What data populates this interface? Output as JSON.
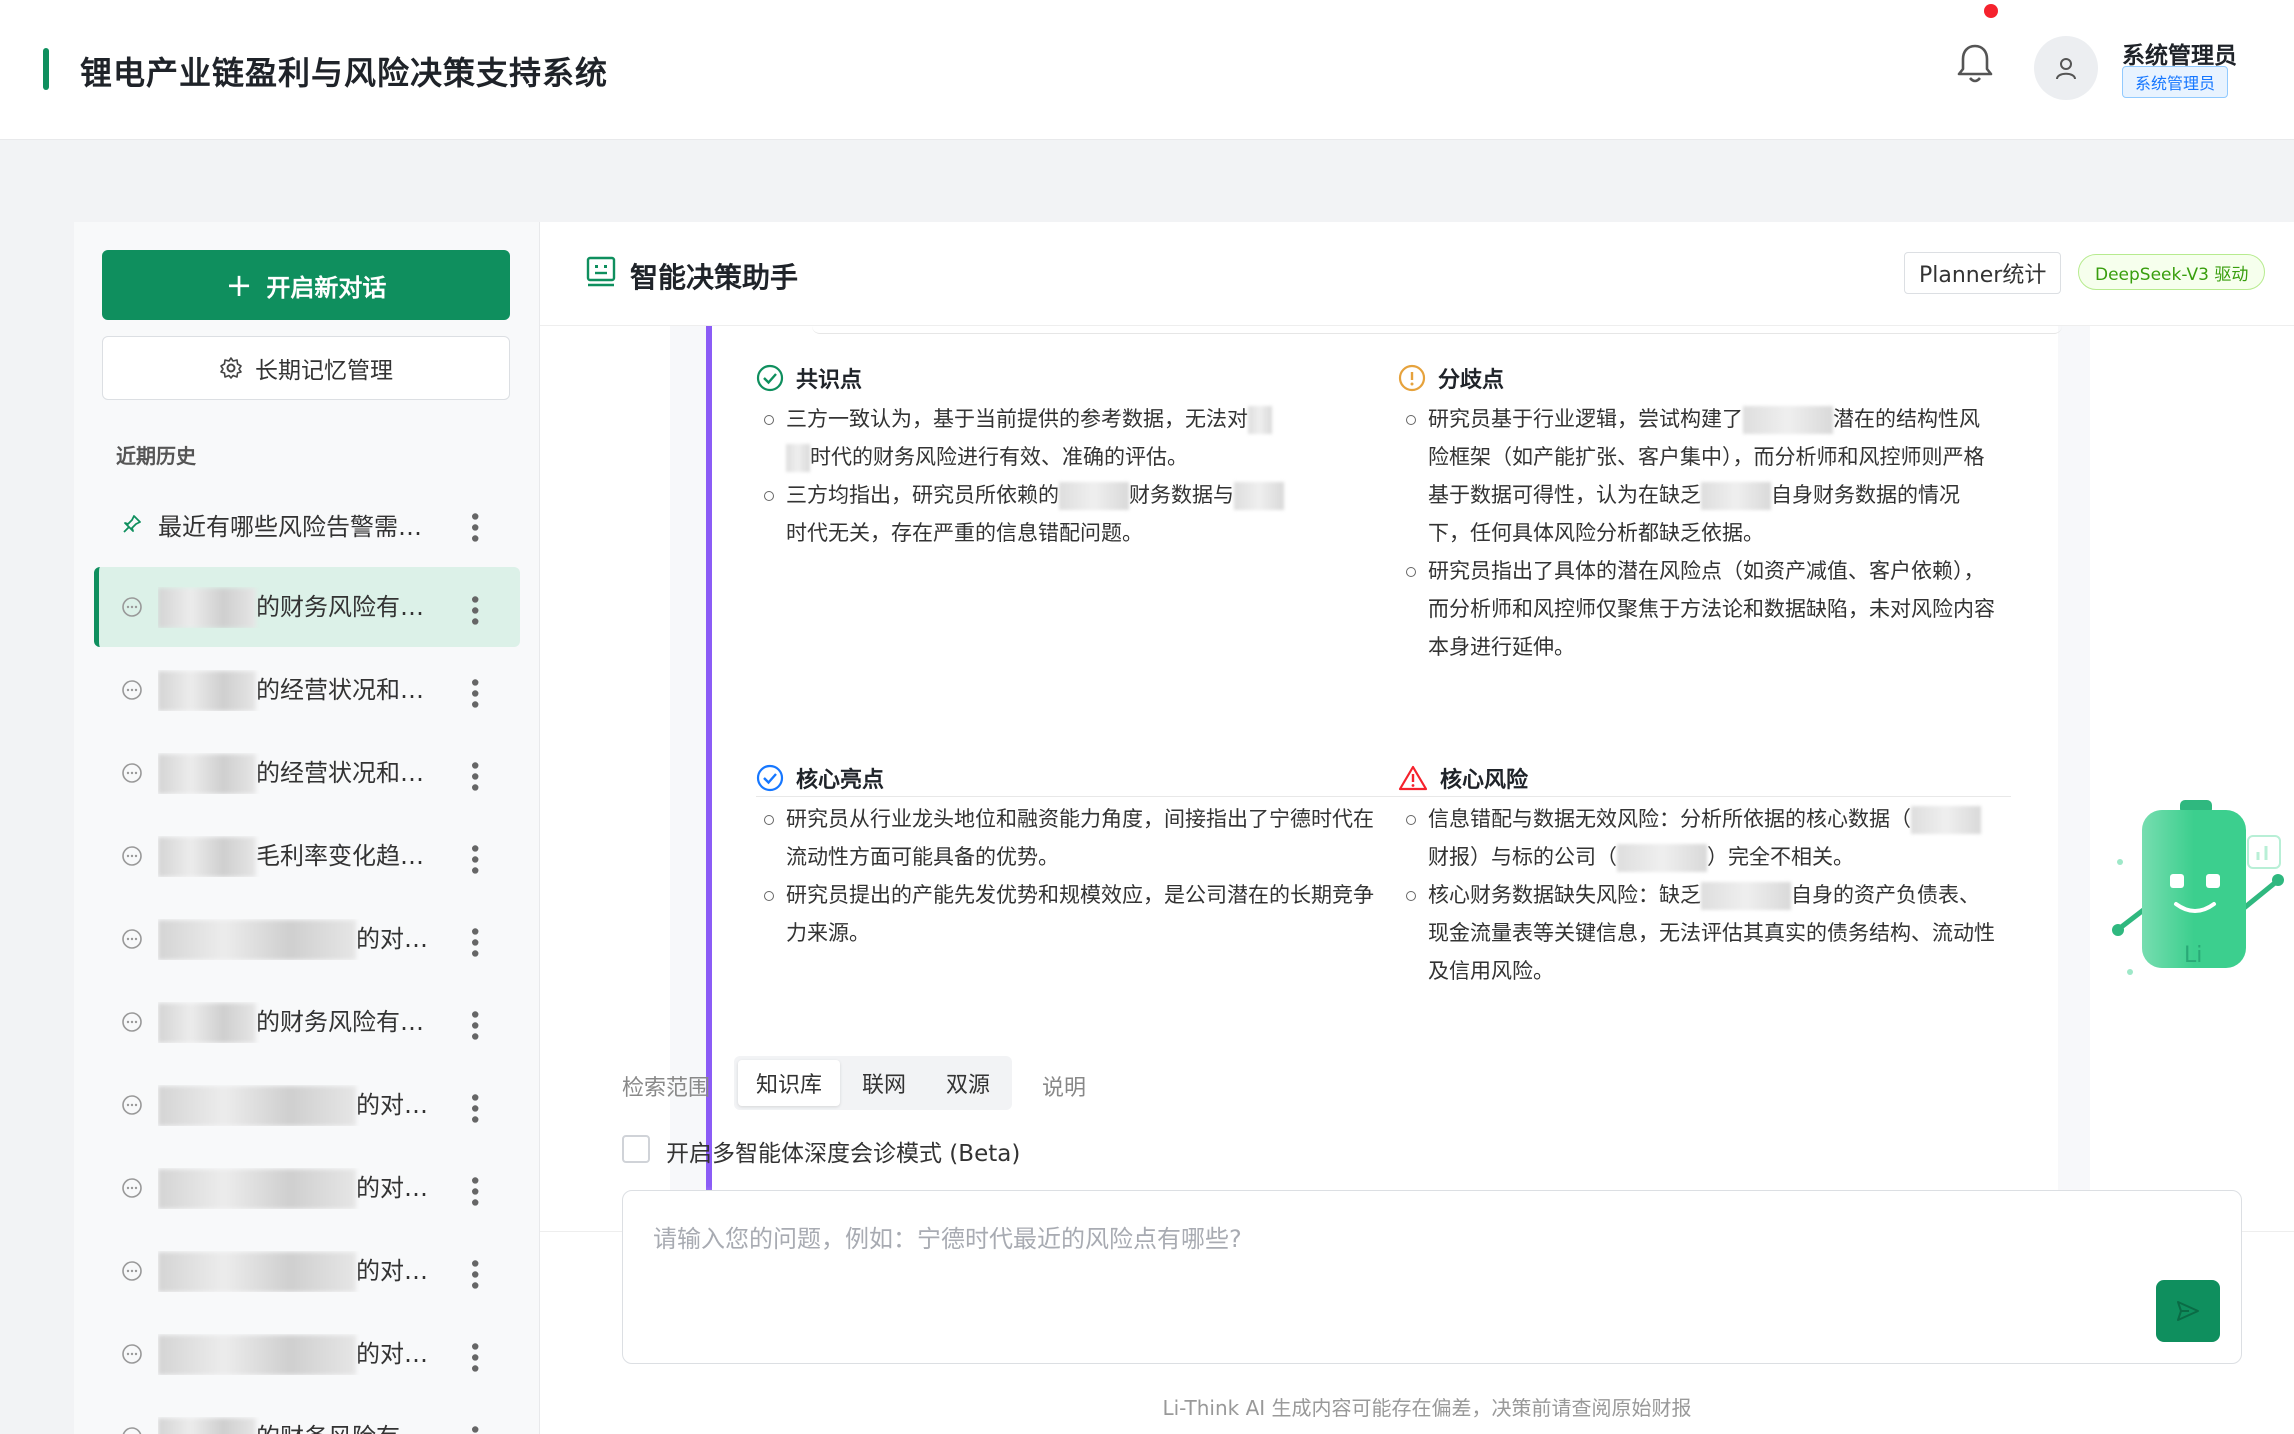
{
  "app": {
    "title": "锂电产业链盈利与风险决策支持系统",
    "brand_color": "#0f8f5e"
  },
  "user": {
    "name": "系统管理员",
    "role": "系统管理员"
  },
  "sidebar": {
    "new_chat_label": "开启新对话",
    "memory_label": "长期记忆管理",
    "history_title": "近期历史",
    "items": [
      {
        "label": "最近有哪些风险告警需…",
        "icon": "pin-icon",
        "active": false
      },
      {
        "label": "的财务风险有…",
        "icon": "chat-icon",
        "active": true
      },
      {
        "label": "的经营状况和…",
        "icon": "chat-icon",
        "active": false
      },
      {
        "label": "的经营状况和…",
        "icon": "chat-icon",
        "active": false
      },
      {
        "label": "毛利率变化趋…",
        "icon": "chat-icon",
        "active": false
      },
      {
        "label": "的对…",
        "icon": "chat-icon",
        "active": false
      },
      {
        "label": "的财务风险有…",
        "icon": "chat-icon",
        "active": false
      },
      {
        "label": "的对…",
        "icon": "chat-icon",
        "active": false
      },
      {
        "label": "的对…",
        "icon": "chat-icon",
        "active": false
      },
      {
        "label": "的对…",
        "icon": "chat-icon",
        "active": false
      },
      {
        "label": "的对…",
        "icon": "chat-icon",
        "active": false
      },
      {
        "label": "的财务风险有…",
        "icon": "chat-icon",
        "active": false
      }
    ]
  },
  "main": {
    "title": "智能决策助手",
    "planner_label": "Planner统计",
    "model_tag": "DeepSeek-V3 驱动",
    "accent_purple": "#8b5cf6"
  },
  "report": {
    "consensus": {
      "title": "共识点",
      "items": [
        [
          "三方一致认为，基于当前提供的参考数据，无法对",
          "时代的财务风险进行有效、准确的评估。"
        ],
        [
          "三方均指出，研究员所依赖的",
          "财务数据与",
          "时代无关，存在严重的信息错配问题。"
        ]
      ]
    },
    "divergence": {
      "title": "分歧点",
      "items": [
        [
          "研究员基于行业逻辑，尝试构建了",
          "潜在的结构性风险框架（如产能扩张、客户集中），而分析师和风控师则严格基于数据可得性，认为在缺乏",
          "自身财务数据的情况下，任何具体风险分析都缺乏依据。"
        ],
        [
          "研究员指出了具体的潜在风险点（如资产减值、客户依赖），而分析师和风控师仅聚焦于方法论和数据缺陷，未对风险内容本身进行延伸。"
        ]
      ]
    },
    "highlights": {
      "title": "核心亮点",
      "items": [
        [
          "研究员从行业龙头地位和融资能力角度，间接指出了宁德时代在流动性方面可能具备的优势。"
        ],
        [
          "研究员提出的产能先发优势和规模效应，是公司潜在的长期竞争力来源。"
        ]
      ]
    },
    "risks": {
      "title": "核心风险",
      "items": [
        [
          "信息错配与数据无效风险：分析所依据的核心数据（",
          "财报）与标的公司（",
          "）完全不相关。"
        ],
        [
          "核心财务数据缺失风险：缺乏",
          "自身的资产负债表、现金流量表等关键信息，无法评估其真实的债务结构、流动性及信用风险。"
        ]
      ]
    }
  },
  "input": {
    "scope_label": "检索范围",
    "scope_options": [
      "知识库",
      "联网",
      "双源"
    ],
    "scope_selected": "知识库",
    "explain_label": "说明",
    "multi_agent_label": "开启多智能体深度会诊模式 (Beta)",
    "multi_agent_checked": false,
    "placeholder": "请输入您的问题，例如：宁德时代最近的风险点有哪些?",
    "disclaimer": "Li-Think AI 生成内容可能存在偏差，决策前请查阅原始财报"
  },
  "mascot": {
    "label": "Li"
  }
}
